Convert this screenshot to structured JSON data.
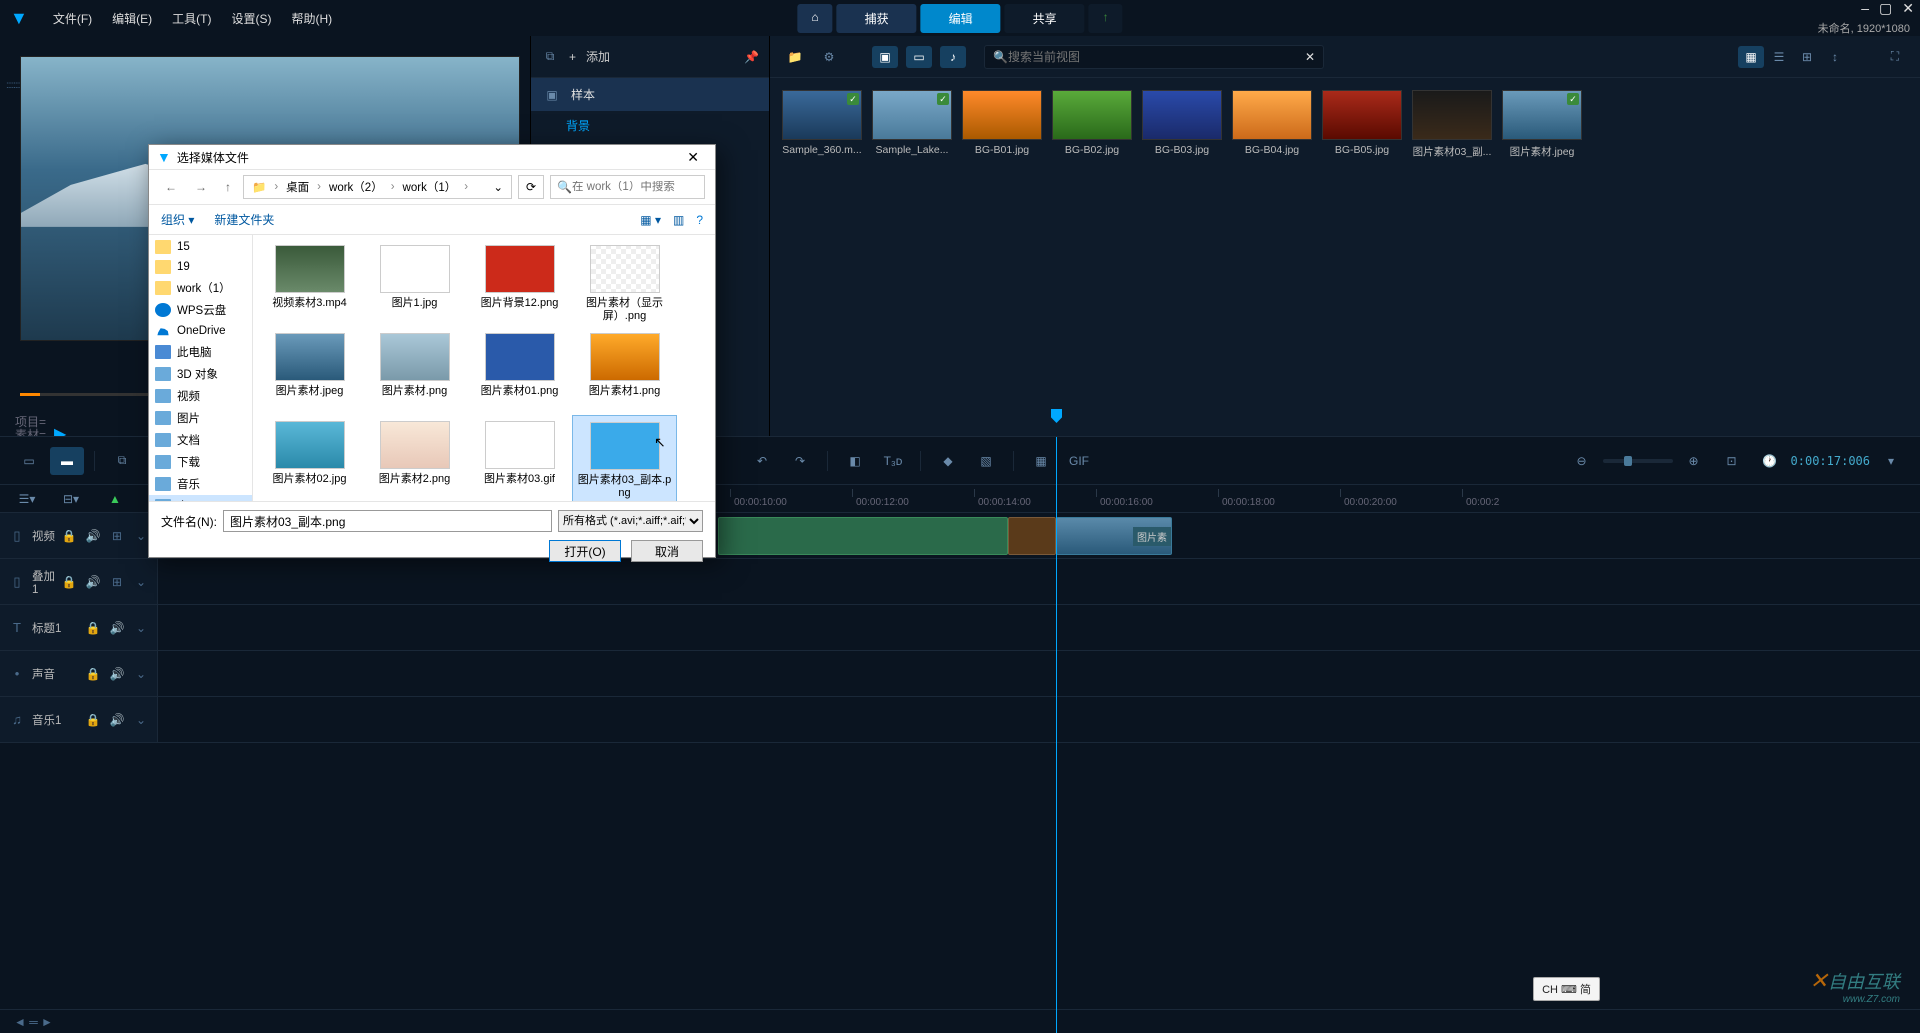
{
  "menubar": {
    "items": [
      "文件(F)",
      "编辑(E)",
      "工具(T)",
      "设置(S)",
      "帮助(H)"
    ],
    "tabs": {
      "home": "⌂",
      "capture": "捕获",
      "edit": "编辑",
      "share": "共享"
    },
    "status": "未命名, 1920*1080"
  },
  "preview": {
    "project_label_1": "项目=",
    "project_label_2": "素材="
  },
  "mid": {
    "add": "添加",
    "icon_items": [
      "📄",
      "♫",
      "✶"
    ],
    "sample": "样本",
    "background": "背景"
  },
  "media": {
    "search_placeholder": "搜索当前视图",
    "items": [
      {
        "label": "Sample_360.m...",
        "bg": "linear-gradient(#3a6a9a,#1a3a5a)",
        "check": true
      },
      {
        "label": "Sample_Lake...",
        "bg": "linear-gradient(#7aa8c8,#4a7a9a)",
        "check": true
      },
      {
        "label": "BG-B01.jpg",
        "bg": "linear-gradient(#ff8a2a,#aa5a00)"
      },
      {
        "label": "BG-B02.jpg",
        "bg": "linear-gradient(#5aaa3a,#2a6a1a)"
      },
      {
        "label": "BG-B03.jpg",
        "bg": "linear-gradient(#2a4aaa,#1a2a6a)"
      },
      {
        "label": "BG-B04.jpg",
        "bg": "linear-gradient(#ffaa4a,#cc6a1a)"
      },
      {
        "label": "BG-B05.jpg",
        "bg": "linear-gradient(#aa2a1a,#5a0a00)"
      },
      {
        "label": "图片素材03_副...",
        "bg": "linear-gradient(#1a1a1a,#3a2a1a)"
      },
      {
        "label": "图片素材.jpeg",
        "bg": "linear-gradient(#6a9aba,#2a5a7a)",
        "check": true
      }
    ]
  },
  "timeline": {
    "timecode": "0:00:17:006",
    "ticks": [
      "00:00:10:00",
      "00:00:12:00",
      "00:00:14:00",
      "00:00:16:00",
      "00:00:18:00",
      "00:00:20:00",
      "00:00:2"
    ],
    "tracks": [
      {
        "name": "视频",
        "icon": "▯",
        "extra": true
      },
      {
        "name": "叠加1",
        "icon": "▯",
        "extra": true
      },
      {
        "name": "标题1",
        "icon": "T",
        "extra": false
      },
      {
        "name": "声音",
        "icon": "•",
        "extra": false
      },
      {
        "name": "音乐1",
        "icon": "♫",
        "extra": false
      }
    ],
    "clip_label": "图片素"
  },
  "ime": "CH ⌨ 简",
  "dialog": {
    "title": "选择媒体文件",
    "nav_parts": [
      "桌面",
      "work（2）",
      "work（1）"
    ],
    "search_placeholder": "在 work（1）中搜索",
    "organize": "组织",
    "new_folder": "新建文件夹",
    "sidebar": [
      {
        "label": "15",
        "cls": "fi-folder"
      },
      {
        "label": "19",
        "cls": "fi-folder"
      },
      {
        "label": "work（1）",
        "cls": "fi-folder"
      },
      {
        "label": "WPS云盘",
        "cls": "fi-cloud"
      },
      {
        "label": "OneDrive",
        "cls": "fi-onedrive"
      },
      {
        "label": "此电脑",
        "cls": "fi-pc"
      },
      {
        "label": "3D 对象",
        "cls": "fi-generic"
      },
      {
        "label": "视频",
        "cls": "fi-generic"
      },
      {
        "label": "图片",
        "cls": "fi-generic"
      },
      {
        "label": "文档",
        "cls": "fi-generic"
      },
      {
        "label": "下载",
        "cls": "fi-generic"
      },
      {
        "label": "音乐",
        "cls": "fi-generic"
      },
      {
        "label": "桌面",
        "cls": "fi-generic",
        "sel": true
      }
    ],
    "files": [
      {
        "label": "视频素材3.mp4",
        "bg": "linear-gradient(#3a5a3a,#6a8a6a)"
      },
      {
        "label": "图片1.jpg",
        "bg": "#fff"
      },
      {
        "label": "图片背景12.png",
        "bg": "#cc2a1a"
      },
      {
        "label": "图片素材（显示屏）.png",
        "bg": "repeating-conic-gradient(#eee 0 25%, #fff 0 50%) 0/10px 10px"
      },
      {
        "label": "图片素材.jpeg",
        "bg": "linear-gradient(#6a9aba,#2a5a7a)"
      },
      {
        "label": "图片素材.png",
        "bg": "linear-gradient(#aac8d8,#7a9aaa)"
      },
      {
        "label": "图片素材01.png",
        "bg": "#2a5aaa"
      },
      {
        "label": "图片素材1.png",
        "bg": "linear-gradient(#ffaa2a,#cc6a00)"
      },
      {
        "label": "图片素材02.jpg",
        "bg": "linear-gradient(#5ab8d8,#2a8aaa)"
      },
      {
        "label": "图片素材2.png",
        "bg": "linear-gradient(#f8e8d8,#e8c8b8)"
      },
      {
        "label": "图片素材03.gif",
        "bg": "#fff"
      },
      {
        "label": "图片素材03_副本.png",
        "bg": "#3aaaea",
        "sel": true
      }
    ],
    "filename_label": "文件名(N):",
    "filename_value": "图片素材03_副本.png",
    "filter": "所有格式 (*.avi;*.aiff;*.aif;*.aifc",
    "open": "打开(O)",
    "cancel": "取消"
  },
  "watermark": {
    "main": "自由互联",
    "sub": "www.Z7.com"
  }
}
